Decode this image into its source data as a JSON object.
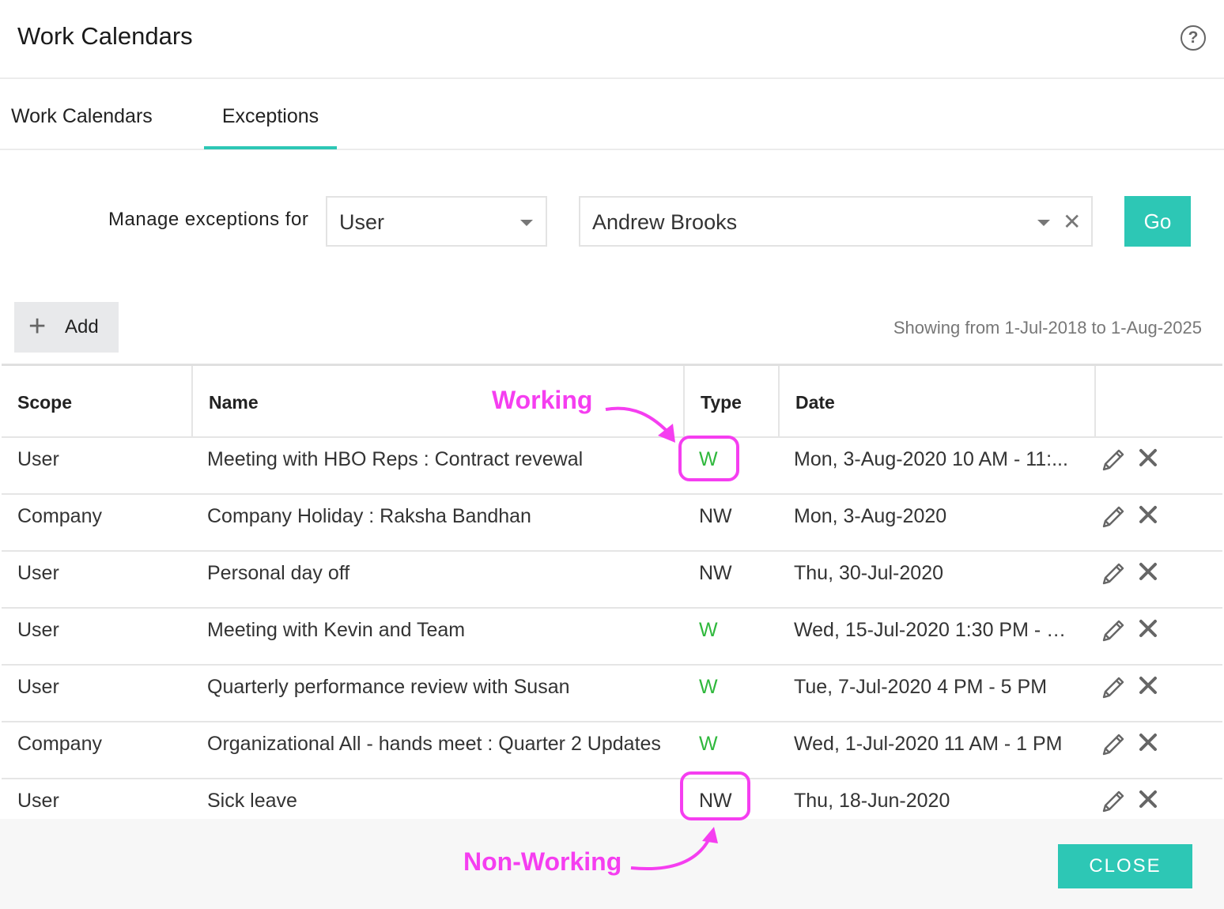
{
  "window": {
    "title": "Work Calendars"
  },
  "tabs": [
    {
      "label": "Work Calendars",
      "active": false
    },
    {
      "label": "Exceptions",
      "active": true
    }
  ],
  "filter": {
    "label": "Manage exceptions for",
    "scope_value": "User",
    "person_value": "Andrew Brooks",
    "go_label": "Go"
  },
  "toolbar": {
    "add_label": "Add",
    "range_text": "Showing from 1-Jul-2018 to 1-Aug-2025"
  },
  "table": {
    "columns": [
      "Scope",
      "Name",
      "Type",
      "Date",
      ""
    ],
    "rows": [
      {
        "scope": "User",
        "name": "Meeting with HBO Reps : Contract revewal",
        "type": "W",
        "date": "Mon, 3-Aug-2020 10 AM - 11:..."
      },
      {
        "scope": "Company",
        "name": "Company Holiday : Raksha Bandhan",
        "type": "NW",
        "date": "Mon, 3-Aug-2020"
      },
      {
        "scope": "User",
        "name": "Personal day off",
        "type": "NW",
        "date": "Thu, 30-Jul-2020"
      },
      {
        "scope": "User",
        "name": "Meeting with Kevin and Team",
        "type": "W",
        "date": "Wed, 15-Jul-2020 1:30 PM - 2:..."
      },
      {
        "scope": "User",
        "name": "Quarterly performance review with Susan",
        "type": "W",
        "date": "Tue, 7-Jul-2020 4 PM - 5 PM"
      },
      {
        "scope": "Company",
        "name": "Organizational All - hands meet : Quarter 2 Updates",
        "type": "W",
        "date": "Wed, 1-Jul-2020 11 AM - 1 PM"
      },
      {
        "scope": "User",
        "name": "Sick leave",
        "type": "NW",
        "date": "Thu, 18-Jun-2020"
      }
    ]
  },
  "footer": {
    "close_label": "CLOSE"
  },
  "annotations": {
    "working": "Working",
    "non_working": "Non-Working"
  },
  "colors": {
    "accent": "#2dc7b5",
    "working_type": "#2fb83c",
    "annotation": "#f53ef0"
  },
  "icons": {
    "help": "help-circle-icon",
    "edit": "pencil-icon",
    "delete": "close-x-icon",
    "add": "plus-icon",
    "clear": "clear-x-icon",
    "dropdown": "caret-down-icon"
  }
}
